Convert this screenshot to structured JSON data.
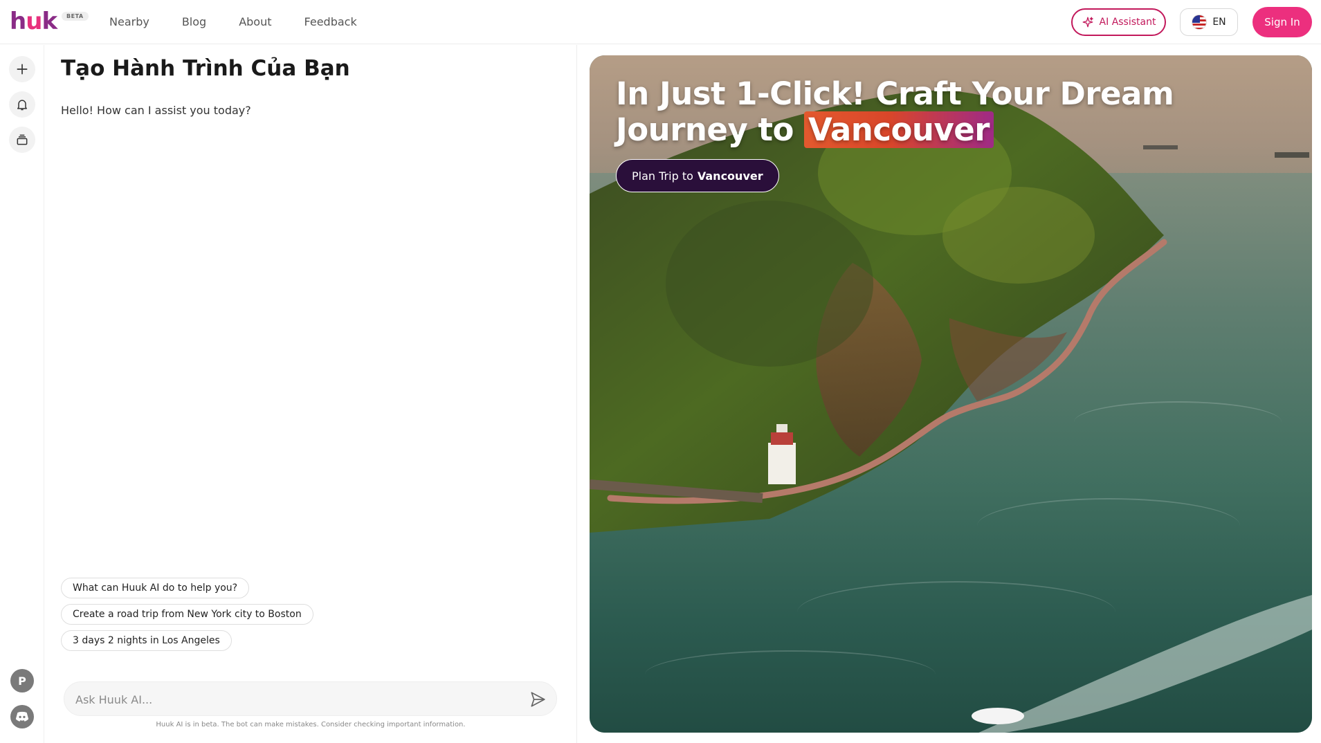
{
  "header": {
    "logo": "huk",
    "beta": "BETA",
    "nav": [
      "Nearby",
      "Blog",
      "About",
      "Feedback"
    ],
    "ai_assistant": "AI Assistant",
    "language": "EN",
    "sign_in": "Sign In"
  },
  "rail": {
    "icons": [
      "plus-icon",
      "bell-icon",
      "stack-icon"
    ],
    "bottom": [
      "p-badge-icon",
      "discord-icon"
    ],
    "p_badge": "P"
  },
  "chat": {
    "title": "Tạo Hành Trình Của Bạn",
    "greeting": "Hello! How can I assist you today?",
    "suggestions": [
      "What can Huuk AI do to help you?",
      "Create a road trip from New York city to Boston",
      "3 days 2 nights in Los Angeles"
    ],
    "input_placeholder": "Ask Huuk AI...",
    "disclaimer": "Huuk AI is in beta. The bot can make mistakes. Consider checking important information."
  },
  "hero": {
    "title_line1": "In Just 1-Click! Craft Your Dream",
    "title_line2_prefix": "Journey to ",
    "title_highlight": "Vancouver",
    "button_prefix": "Plan Trip to",
    "button_city": "Vancouver"
  },
  "colors": {
    "brand_pink": "#ec2f7e",
    "brand_purple": "#8a2b86",
    "hero_button_bg": "#2a0f3a"
  }
}
